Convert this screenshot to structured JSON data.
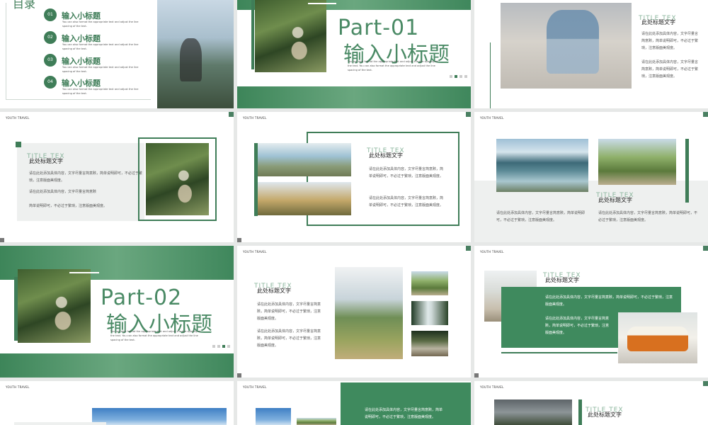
{
  "brand": "YOUTH TRAVEL",
  "ghost_title": "TITLE TEX",
  "slide_title": "此处标题文字",
  "body_cn_a": "请在此处添加具体内容，文字尽量言简意赅，简单说明即可，不必过于繁琐，注意版面美观度。",
  "body_cn_b": "请在此处添加具体内容，文字尽量言简意赅",
  "body_cn_c": "简单说明即可，不必过于繁琐，注意版面美观度。",
  "en_small": "You can also format the appropriate text and adjust the line spacing of the text.",
  "en_part": "You can also format the appropriate text and adjust the line spacing of the text. You can also format the appropriate text and adjust the line spacing of the text.",
  "toc": {
    "heading": "目录",
    "items": [
      {
        "num": "01",
        "label": "输入小标题"
      },
      {
        "num": "02",
        "label": "输入小标题"
      },
      {
        "num": "03",
        "label": "输入小标题"
      },
      {
        "num": "04",
        "label": "输入小标题"
      }
    ]
  },
  "part1": {
    "title": "Part-01",
    "subtitle": "输入小标题"
  },
  "part2": {
    "title": "Part-02",
    "subtitle": "输入小标题"
  },
  "colors": {
    "accent": "#3f7d58",
    "light_accent": "#8ab59c"
  }
}
